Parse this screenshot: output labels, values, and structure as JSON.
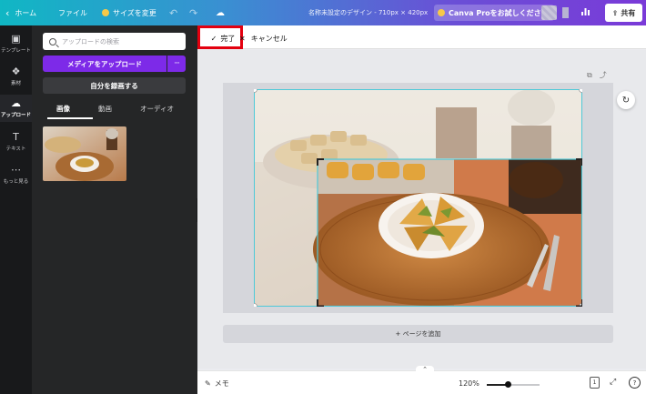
{
  "topbar": {
    "home_label": "ホーム",
    "file_label": "ファイル",
    "resize_label": "サイズを変更",
    "doc_title": "名称未設定のデザイン - 710px × 420px",
    "pro_label": "Canva Proをお試しください",
    "share_label": "共有"
  },
  "rail": [
    {
      "label": "テンプレート",
      "icon": "template-icon"
    },
    {
      "label": "素材",
      "icon": "elements-icon"
    },
    {
      "label": "アップロード",
      "icon": "upload-icon"
    },
    {
      "label": "テキスト",
      "icon": "text-icon"
    },
    {
      "label": "もっと見る",
      "icon": "more-icon"
    }
  ],
  "panel": {
    "search_placeholder": "アップロードの検索",
    "upload_button": "メディアをアップロード",
    "more_button": "···",
    "record_button": "自分を録画する",
    "tabs": [
      "画像",
      "動画",
      "オーディオ"
    ]
  },
  "toolbar": {
    "done_label": "完了",
    "cancel_label": "キャンセル"
  },
  "canvas": {
    "add_page_label": "+ ページを追加"
  },
  "footer": {
    "memo_label": "メモ",
    "zoom_label": "120%",
    "zoom_fraction": 0.4,
    "page_count": "1",
    "help_label": "?"
  },
  "colors": {
    "accent": "#7d2ae8",
    "highlight": "#e3000f",
    "crop_handle": "#4ec9d8"
  }
}
